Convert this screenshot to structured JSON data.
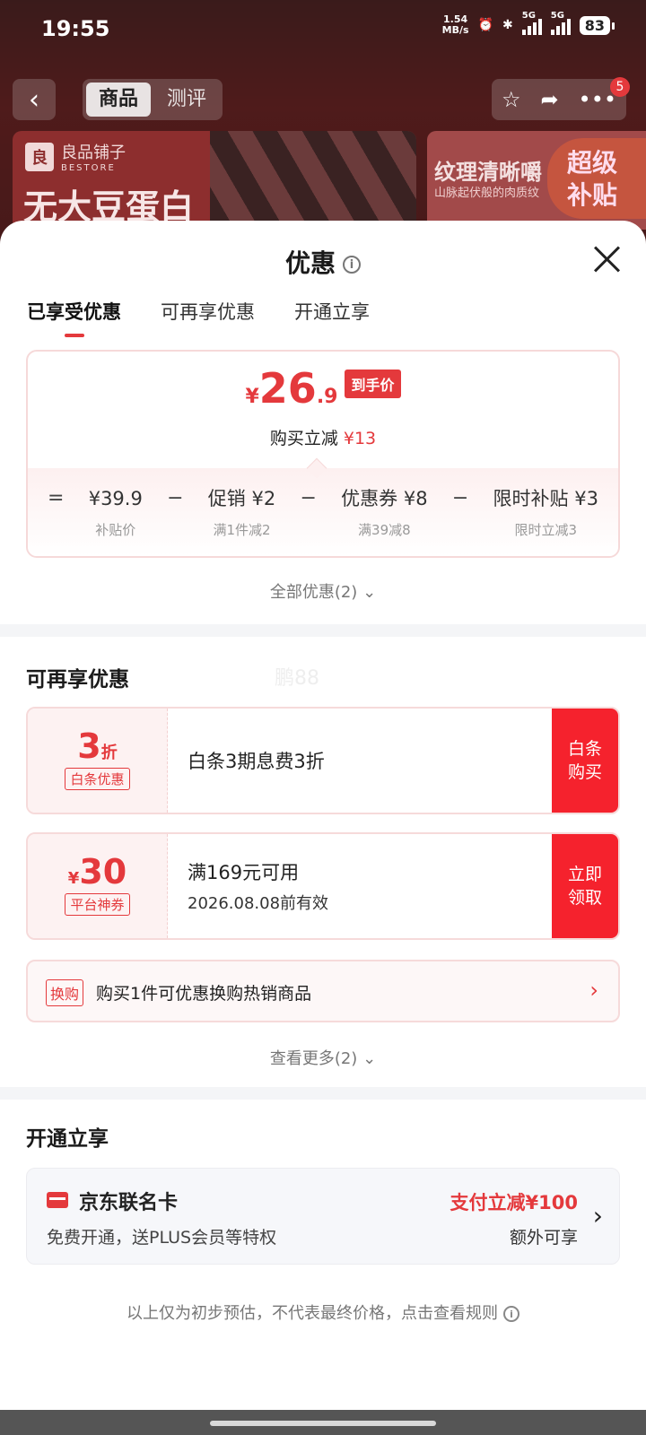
{
  "status_bar": {
    "time": "19:55",
    "net_speed_value": "1.54",
    "net_speed_unit": "MB/s",
    "sig1_label": "5G",
    "sig2_label": "5G",
    "battery": "83"
  },
  "background": {
    "back_icon": "back-arrow-icon",
    "tabs": [
      "商品",
      "测评"
    ],
    "badge_count": "5",
    "brand_name": "良品铺子",
    "brand_en": "BESTORE",
    "banner_text": "无大豆蛋白",
    "banner2_title": "纹理清晰嚼",
    "banner2_sub": "山脉起伏般的肉质纹",
    "banner2_badge_line1": "超级",
    "banner2_badge_line2": "补贴"
  },
  "sheet": {
    "title": "优惠",
    "tabs": [
      "已享受优惠",
      "可再享优惠",
      "开通立享"
    ],
    "active_tab": "已享受优惠",
    "final_price": {
      "currency": "¥",
      "integer": "26",
      "decimal": ".9",
      "tag": "到手价"
    },
    "reduce_label": "购买立减",
    "reduce_amount": "¥13",
    "formula": [
      {
        "op": "=",
        "value": "¥39.9",
        "note": "补贴价"
      },
      {
        "op": "−",
        "value": "促销 ¥2",
        "note": "满1件减2"
      },
      {
        "op": "−",
        "value": "优惠券 ¥8",
        "note": "满39减8"
      },
      {
        "op": "−",
        "value": "限时补贴 ¥3",
        "note": "限时立减3"
      }
    ],
    "all_promo": "全部优惠(2)",
    "more_title": "可再享优惠",
    "watermark": "鹏88",
    "coupons": [
      {
        "amount": "3",
        "unit": "折",
        "prefix": "",
        "label": "白条优惠",
        "line1": "白条3期息费3折",
        "line2": "",
        "button_line1": "白条",
        "button_line2": "购买"
      },
      {
        "amount": "30",
        "unit": "",
        "prefix": "¥",
        "label": "平台神券",
        "line1": "满169元可用",
        "line2": "2026.08.08前有效",
        "button_line1": "立即",
        "button_line2": "领取"
      }
    ],
    "swap": {
      "tag": "换购",
      "text": "购买1件可优惠换购热销商品"
    },
    "see_more": "查看更多(2)",
    "open_title": "开通立享",
    "jd_card": {
      "name": "京东联名卡",
      "desc": "免费开通，送PLUS会员等特权",
      "promo": "支付立减¥100",
      "extra": "额外可享"
    },
    "footnote": "以上仅为初步预估，不代表最终价格，点击查看规则"
  }
}
